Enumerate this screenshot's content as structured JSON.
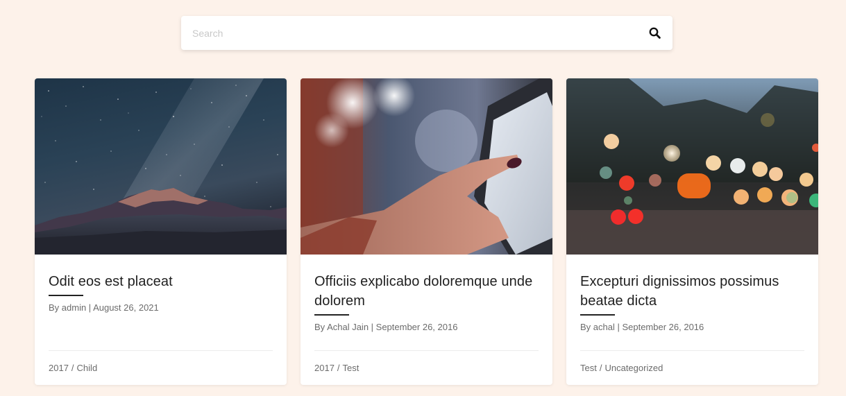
{
  "search": {
    "placeholder": "Search",
    "value": "",
    "icon": "search-icon"
  },
  "posts": [
    {
      "title": "Odit eos est placeat",
      "author": "admin",
      "date": "August 26, 2021",
      "meta": "By admin | August 26, 2021",
      "categories": [
        "2017",
        "Child"
      ],
      "image": "starry-night-mountain"
    },
    {
      "title": "Officiis explicabo doloremque unde dolorem",
      "author": "Achal Jain",
      "date": "September 26, 2016",
      "meta": "By Achal Jain | September 26, 2016",
      "categories": [
        "2017",
        "Test"
      ],
      "image": "finger-touching-tablet"
    },
    {
      "title": "Excepturi dignissimos possimus beatae dicta",
      "author": "achal",
      "date": "September 26, 2016",
      "meta": "By achal | September 26, 2016",
      "categories": [
        "Test",
        "Uncategorized"
      ],
      "image": "bokeh-street-lights"
    }
  ],
  "colors": {
    "background": "#fdf2ea",
    "card": "#ffffff",
    "title": "#1f1f1f",
    "meta": "#6b6b6b"
  }
}
